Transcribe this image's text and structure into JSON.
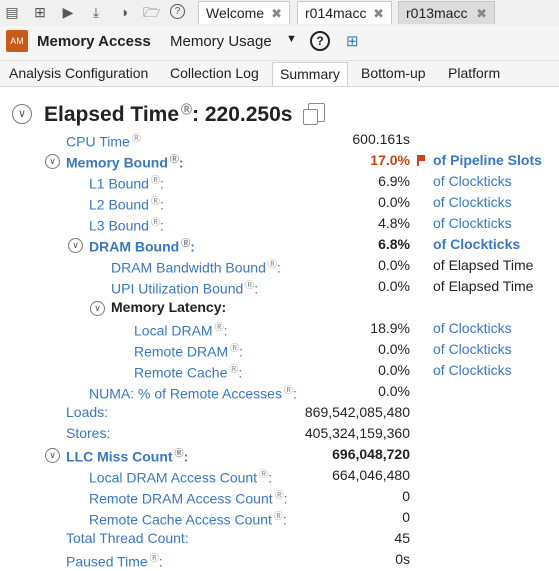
{
  "toolbar": {
    "icons": [
      "run-icon",
      "add-icon",
      "play-icon",
      "download-icon",
      "compare-icon",
      "open-icon",
      "help-icon"
    ],
    "tabs": [
      {
        "label": "Welcome",
        "active": false
      },
      {
        "label": "r014macc",
        "active": false
      },
      {
        "label": "r013macc",
        "active": true
      }
    ]
  },
  "header": {
    "logo_text": "AM",
    "title": "Memory Access",
    "analysis": "Memory Usage"
  },
  "subtabs": [
    "Analysis Configuration",
    "Collection Log",
    "Summary",
    "Bottom-up",
    "Platform"
  ],
  "summary": {
    "elapsed_title": "Elapsed Time",
    "elapsed_value": ": 220.250s",
    "rows": [
      {
        "label": "CPU Time",
        "value": "600.161s",
        "unit": ""
      },
      {
        "label": "Memory Bound",
        "value": "17.0%",
        "unit": "of Pipeline Slots"
      },
      {
        "label": "L1 Bound",
        "value": "6.9%",
        "unit": "of Clockticks"
      },
      {
        "label": "L2 Bound",
        "value": "0.0%",
        "unit": "of Clockticks"
      },
      {
        "label": "L3 Bound",
        "value": "4.8%",
        "unit": "of Clockticks"
      },
      {
        "label": "DRAM Bound",
        "value": "6.8%",
        "unit": "of Clockticks"
      },
      {
        "label": "DRAM Bandwidth Bound",
        "value": "0.0%",
        "unit": "of Elapsed Time"
      },
      {
        "label": "UPI Utilization Bound",
        "value": "0.0%",
        "unit": "of Elapsed Time"
      },
      {
        "label": "Memory Latency:",
        "value": "",
        "unit": ""
      },
      {
        "label": "Local DRAM",
        "value": "18.9%",
        "unit": "of Clockticks"
      },
      {
        "label": "Remote DRAM",
        "value": "0.0%",
        "unit": "of Clockticks"
      },
      {
        "label": "Remote Cache",
        "value": "0.0%",
        "unit": "of Clockticks"
      },
      {
        "label": "NUMA: % of Remote Accesses",
        "value": "0.0%",
        "unit": ""
      },
      {
        "label": "Loads:",
        "value": "869,542,085,480",
        "unit": ""
      },
      {
        "label": "Stores:",
        "value": "405,324,159,360",
        "unit": ""
      },
      {
        "label": "LLC Miss Count",
        "value": "696,048,720",
        "unit": ""
      },
      {
        "label": "Local DRAM Access Count",
        "value": "664,046,480",
        "unit": ""
      },
      {
        "label": "Remote DRAM Access Count",
        "value": "0",
        "unit": ""
      },
      {
        "label": "Remote Cache Access Count",
        "value": "0",
        "unit": ""
      },
      {
        "label": "Total Thread Count:",
        "value": "45",
        "unit": ""
      },
      {
        "label": "Paused Time",
        "value": "0s",
        "unit": ""
      }
    ]
  }
}
